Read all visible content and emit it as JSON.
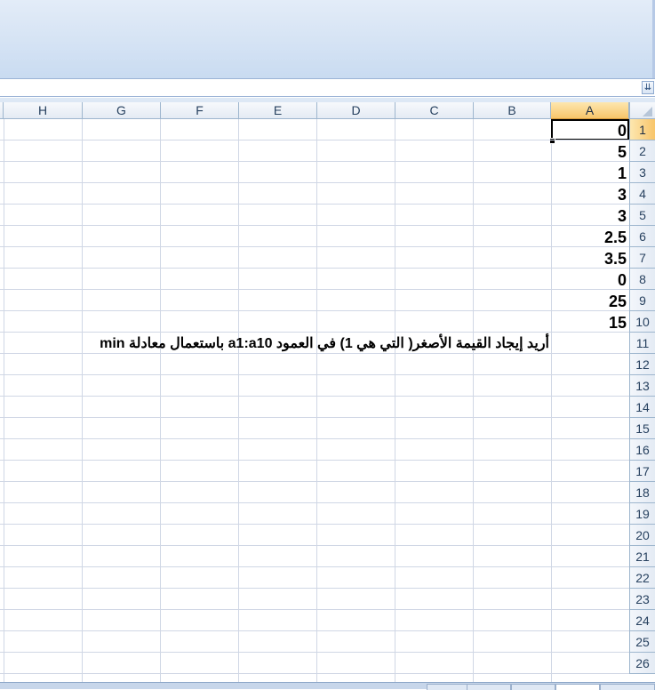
{
  "columns": [
    "A",
    "B",
    "C",
    "D",
    "E",
    "F",
    "G",
    "H"
  ],
  "active_column": "A",
  "active_row": "1",
  "rows": [
    "1",
    "2",
    "3",
    "4",
    "5",
    "6",
    "7",
    "8",
    "9",
    "10",
    "11",
    "12",
    "13",
    "14",
    "15",
    "16",
    "17",
    "18",
    "19",
    "20",
    "21",
    "22",
    "23",
    "24",
    "25",
    "26"
  ],
  "cells": {
    "A1": "0",
    "A2": "5",
    "A3": "1",
    "A4": "3",
    "A5": "3",
    "A6": "2.5",
    "A7": "3.5",
    "A8": "0",
    "A9": "25",
    "A10": "15",
    "A11": "أريد إيجاد القيمة الأصغر( التي هي 1) في العمود a1:a10 باستعمال معادلة min"
  },
  "formula_bar": {
    "expand_icon": "chevron-double-down-icon"
  },
  "colors": {
    "grid": "#d0d7e5",
    "header_active": "#f8c56a",
    "ribbon": "#d5e3f4"
  }
}
